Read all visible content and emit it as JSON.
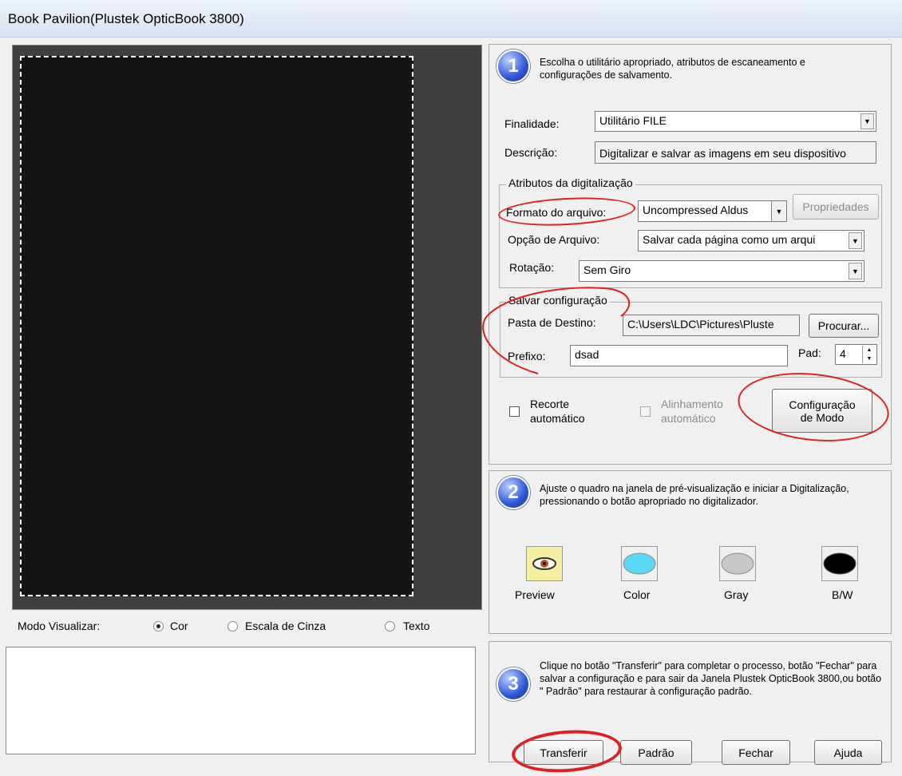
{
  "window": {
    "title": "Book Pavilion(Plustek OpticBook 3800)"
  },
  "view_mode": {
    "label": "Modo Visualizar:",
    "options": [
      {
        "label": "Cor",
        "selected": true
      },
      {
        "label": "Escala de Cinza",
        "selected": false
      },
      {
        "label": "Texto",
        "selected": false
      }
    ]
  },
  "step1": {
    "number": "1",
    "text": "Escolha o utilitário apropriado, atributos de escaneamento e configurações de salvamento.",
    "purpose_label": "Finalidade:",
    "purpose_value": "Utilitário FILE",
    "description_label": "Descrição:",
    "description_value": "Digitalizar e salvar as imagens em seu dispositivo",
    "scan_attrs": {
      "title": "Atributos da digitalização",
      "format_label": "Formato do arquivo:",
      "format_value": "Uncompressed Aldus",
      "properties_button": "Propriedades",
      "file_option_label": "Opção de Arquivo:",
      "file_option_value": "Salvar cada página como um arqui",
      "rotation_label": "Rotação:",
      "rotation_value": "Sem Giro"
    },
    "save_config": {
      "title": "Salvar configuração",
      "dest_label": "Pasta de Destino:",
      "dest_value": "C:\\Users\\LDC\\Pictures\\Pluste",
      "browse_button": "Procurar...",
      "prefix_label": "Prefixo:",
      "prefix_value": "dsad",
      "pad_label": "Pad:",
      "pad_value": "4"
    },
    "auto_crop_line1": "Recorte",
    "auto_crop_line2": "automático",
    "auto_align_line1": "Alinhamento",
    "auto_align_line2": "automático",
    "mode_config_line1": "Configuração",
    "mode_config_line2": "de Modo"
  },
  "step2": {
    "number": "2",
    "text": "Ajuste o quadro na janela de pré-visualização e iniciar a Digitalização, pressionando o botão apropriado no digitalizador.",
    "buttons": [
      {
        "label": "Preview",
        "icon": "eye-icon"
      },
      {
        "label": "Color",
        "icon": "color-icon",
        "color": "#5ad8f5"
      },
      {
        "label": "Gray",
        "icon": "gray-icon",
        "color": "#c8c8c8"
      },
      {
        "label": "B/W",
        "icon": "bw-icon",
        "color": "#000000"
      }
    ]
  },
  "step3": {
    "number": "3",
    "text": "Clique no botão \"Transferir\" para completar o processo, botão \"Fechar\" para salvar a configuração e para sair da Janela Plustek OpticBook 3800,ou botão \" Padrão\" para restaurar à configuração padrão.",
    "transfer_button": "Transferir",
    "default_button": "Padrão",
    "close_button": "Fechar",
    "help_button": "Ajuda"
  },
  "colors": {
    "annotation": "#e02020",
    "step_badge": "#2f56d8"
  }
}
